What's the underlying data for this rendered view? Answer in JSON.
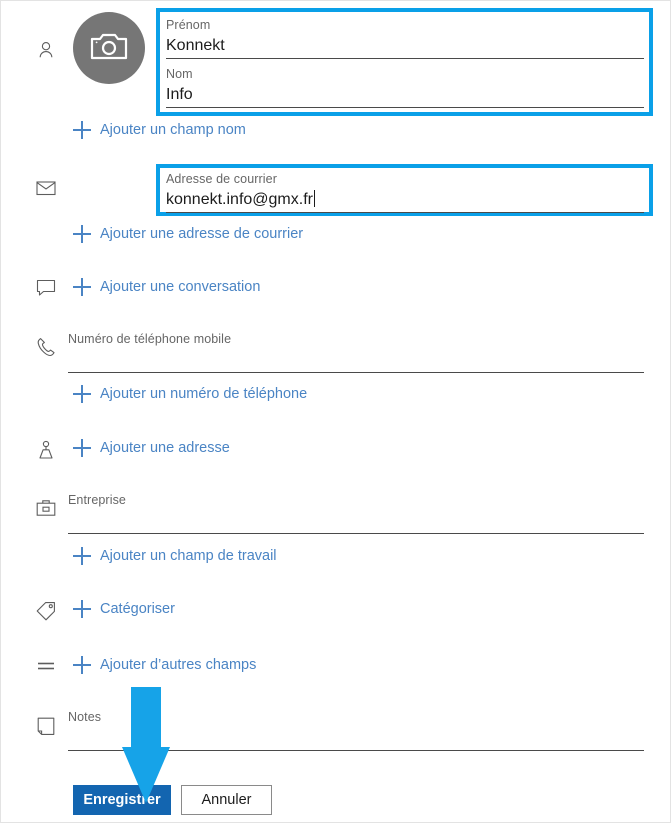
{
  "app": {
    "accent_highlight_color": "#0aa0e8",
    "link_color": "#4a84c4",
    "save_button_color": "#1365b0",
    "avatar_color": "#767676"
  },
  "avatar": {
    "icon": "camera-icon"
  },
  "sections": {
    "name": {
      "gutter_icon": "person-icon",
      "highlighted": true,
      "fields": [
        {
          "label": "Prénom",
          "value": "Konnekt",
          "caret": false
        },
        {
          "label": "Nom",
          "value": "Info",
          "caret": false
        }
      ],
      "add_link": "Ajouter un champ nom"
    },
    "email": {
      "gutter_icon": "envelope-icon",
      "highlighted": true,
      "fields": [
        {
          "label": "Adresse de courrier",
          "value": "konnekt.info@gmx.fr",
          "caret": true
        }
      ],
      "add_link": "Ajouter une adresse de courrier"
    },
    "chat": {
      "gutter_icon": "chat-bubble-icon",
      "add_link": "Ajouter une conversation"
    },
    "phone": {
      "gutter_icon": "phone-icon",
      "fields": [
        {
          "label": "Numéro de téléphone mobile",
          "value": "",
          "caret": false
        }
      ],
      "add_link": "Ajouter un numéro de téléphone"
    },
    "address": {
      "gutter_icon": "map-pin-icon",
      "add_link": "Ajouter une adresse"
    },
    "work": {
      "gutter_icon": "briefcase-icon",
      "fields": [
        {
          "label": "Entreprise",
          "value": "",
          "caret": false
        }
      ],
      "add_link": "Ajouter un champ de travail"
    },
    "category": {
      "gutter_icon": "tag-icon",
      "add_link": "Catégoriser"
    },
    "other": {
      "gutter_icon": "list-lines-icon",
      "add_link": "Ajouter d’autres champs"
    },
    "notes": {
      "gutter_icon": "note-icon",
      "fields": [
        {
          "label": "Notes",
          "value": "",
          "caret": false
        }
      ]
    }
  },
  "footer": {
    "save_label": "Enregistrer",
    "cancel_label": "Annuler"
  },
  "annotation": {
    "arrow": "down-arrow-annotation"
  }
}
